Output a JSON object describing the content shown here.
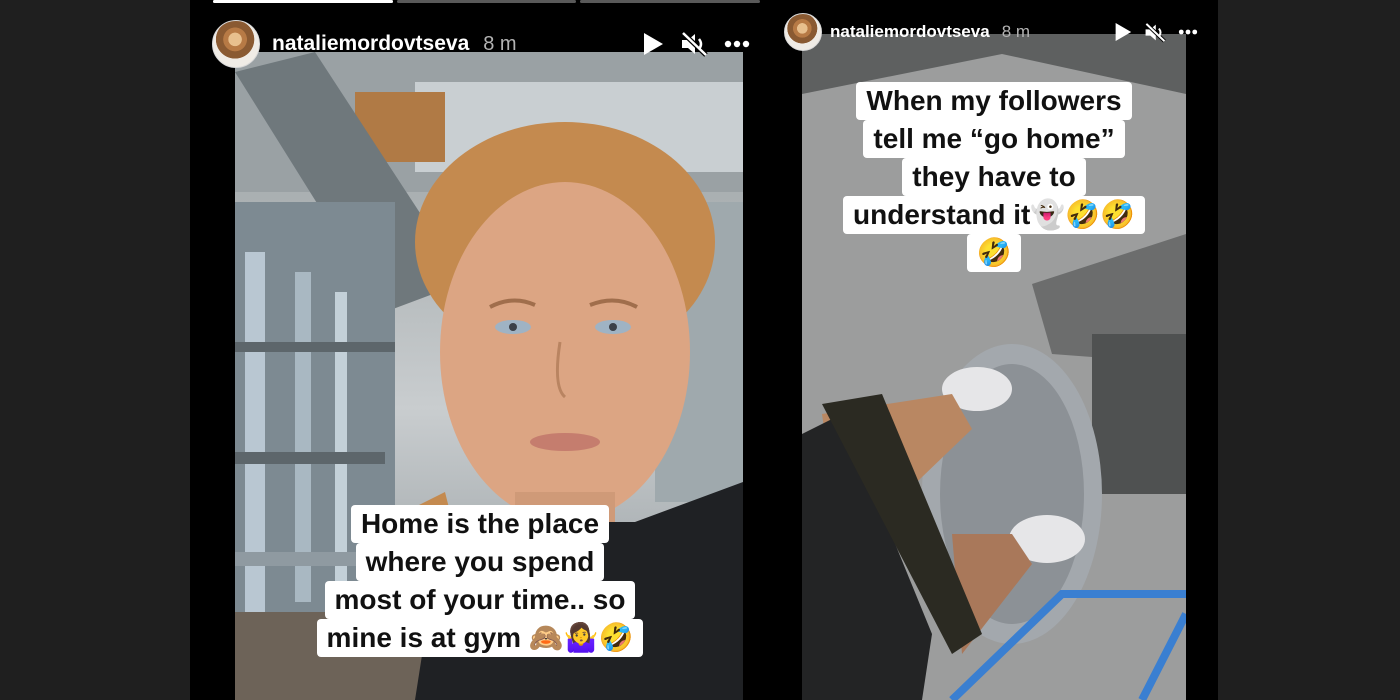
{
  "stories": [
    {
      "username": "nataliemordovtseva",
      "time": "8 m",
      "progress": [
        1.0,
        0.0,
        0.0
      ],
      "caption_lines": [
        "Home is the place",
        "where you spend",
        "most of your time.. so",
        "mine is at gym 🙈🤷‍♀️🤣"
      ],
      "icons": [
        "play-icon",
        "mute-icon",
        "more-icon"
      ]
    },
    {
      "username": "nataliemordovtseva",
      "time": "8 m",
      "caption_lines": [
        "When my followers",
        "tell me “go home”",
        "they have to",
        "understand it👻🤣🤣",
        "🤣"
      ],
      "icons": [
        "play-icon",
        "mute-icon",
        "more-icon"
      ]
    }
  ]
}
